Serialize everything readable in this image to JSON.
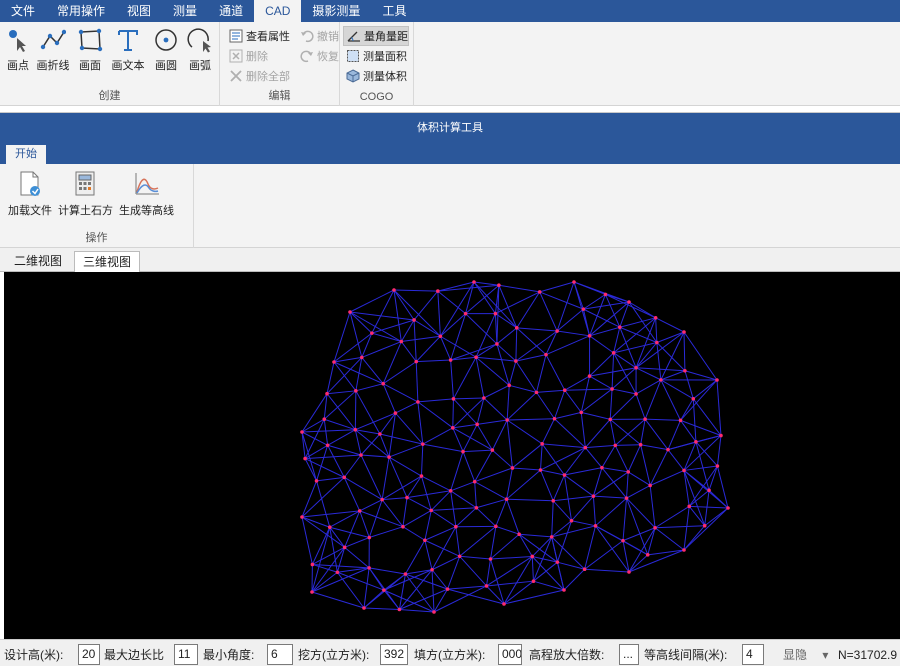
{
  "menubar": {
    "tabs": [
      "文件",
      "常用操作",
      "视图",
      "测量",
      "通道",
      "CAD",
      "摄影测量",
      "工具"
    ]
  },
  "ribbon": {
    "create": {
      "title": "创建",
      "buttons": [
        "画点",
        "画折线",
        "画面",
        "画文本",
        "画圆",
        "画弧"
      ]
    },
    "edit": {
      "title": "编辑",
      "col1": [
        "查看属性",
        "删除",
        "删除全部"
      ],
      "col2": [
        "撤销",
        "恢复"
      ]
    },
    "cogo": {
      "title": "COGO",
      "buttons": [
        "量角量距",
        "测量面积",
        "测量体积"
      ]
    }
  },
  "window": {
    "title": "体积计算工具",
    "tab": "开始",
    "group_title": "操作",
    "buttons": [
      "加载文件",
      "计算土石方",
      "生成等高线"
    ],
    "view_tabs": [
      "二维视图",
      "三维视图"
    ]
  },
  "statusbar": {
    "design_height_label": "设计高(米):",
    "design_height_value": "20",
    "max_edge_ratio_label": "最大边长比",
    "max_edge_ratio_value": "11",
    "min_angle_label": "最小角度:",
    "min_angle_value": "6",
    "cut_label": "挖方(立方米):",
    "cut_value": "392",
    "fill_label": "填方(立方米):",
    "fill_value": "000",
    "elev_scale_label": "高程放大倍数:",
    "elev_scale_value": "...",
    "contour_interval_label": "等高线间隔(米):",
    "contour_interval_value": "4",
    "display_dropdown": "显隐",
    "coord_readout": "N=31702.9"
  },
  "colors": {
    "ribbon_blue": "#2b579a",
    "tin_edge": "#2a2ad8",
    "tin_vertex": "#ff2a6d"
  },
  "icons": {
    "draw_point": "point-arrow-icon",
    "draw_polyline": "polyline-icon",
    "draw_polygon": "polygon-icon",
    "draw_text": "text-T-icon",
    "draw_circle": "circle-icon",
    "draw_arc": "arc-icon"
  }
}
